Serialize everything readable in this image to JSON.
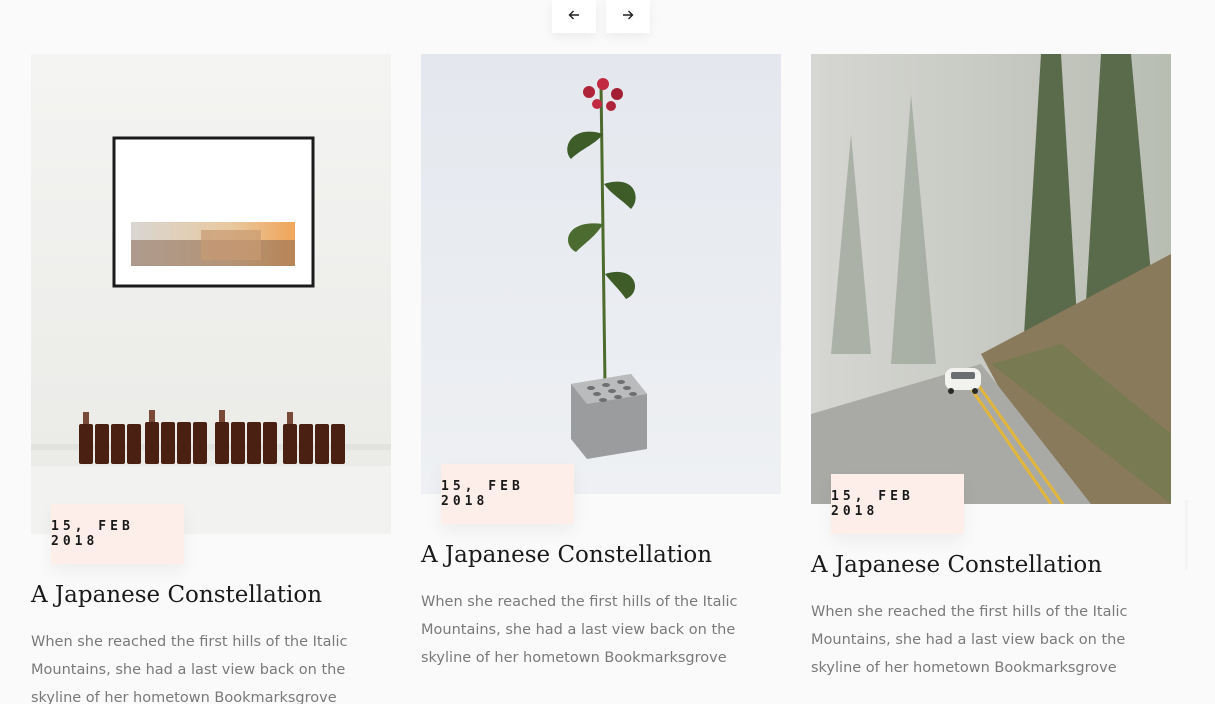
{
  "carousel": {
    "prev_icon": "arrow-left-icon",
    "next_icon": "arrow-right-icon"
  },
  "cards": [
    {
      "image": "gallery-frame-bottles-photo",
      "date": "15, FEB 2018",
      "title": "A Japanese Constellation",
      "excerpt": "When she reached the first hills of the Italic Mountains, she had a last view back on the skyline of her hometown Bookmarksgrove"
    },
    {
      "image": "flower-in-concrete-block-photo",
      "date": "15, FEB 2018",
      "title": "A Japanese Constellation",
      "excerpt": "When she reached the first hills of the Italic Mountains, she had a last view back on the skyline of her hometown Bookmarksgrove"
    },
    {
      "image": "foggy-forest-road-car-photo",
      "date": "15, FEB 2018",
      "title": "A Japanese Constellation",
      "excerpt": "When she reached the first hills of the Italic Mountains, she had a last view back on the skyline of her hometown Bookmarksgrove"
    }
  ],
  "colors": {
    "background": "#fafafa",
    "badge": "#fdeee9",
    "title": "#1a1a1a",
    "text": "#7a7a7a"
  }
}
